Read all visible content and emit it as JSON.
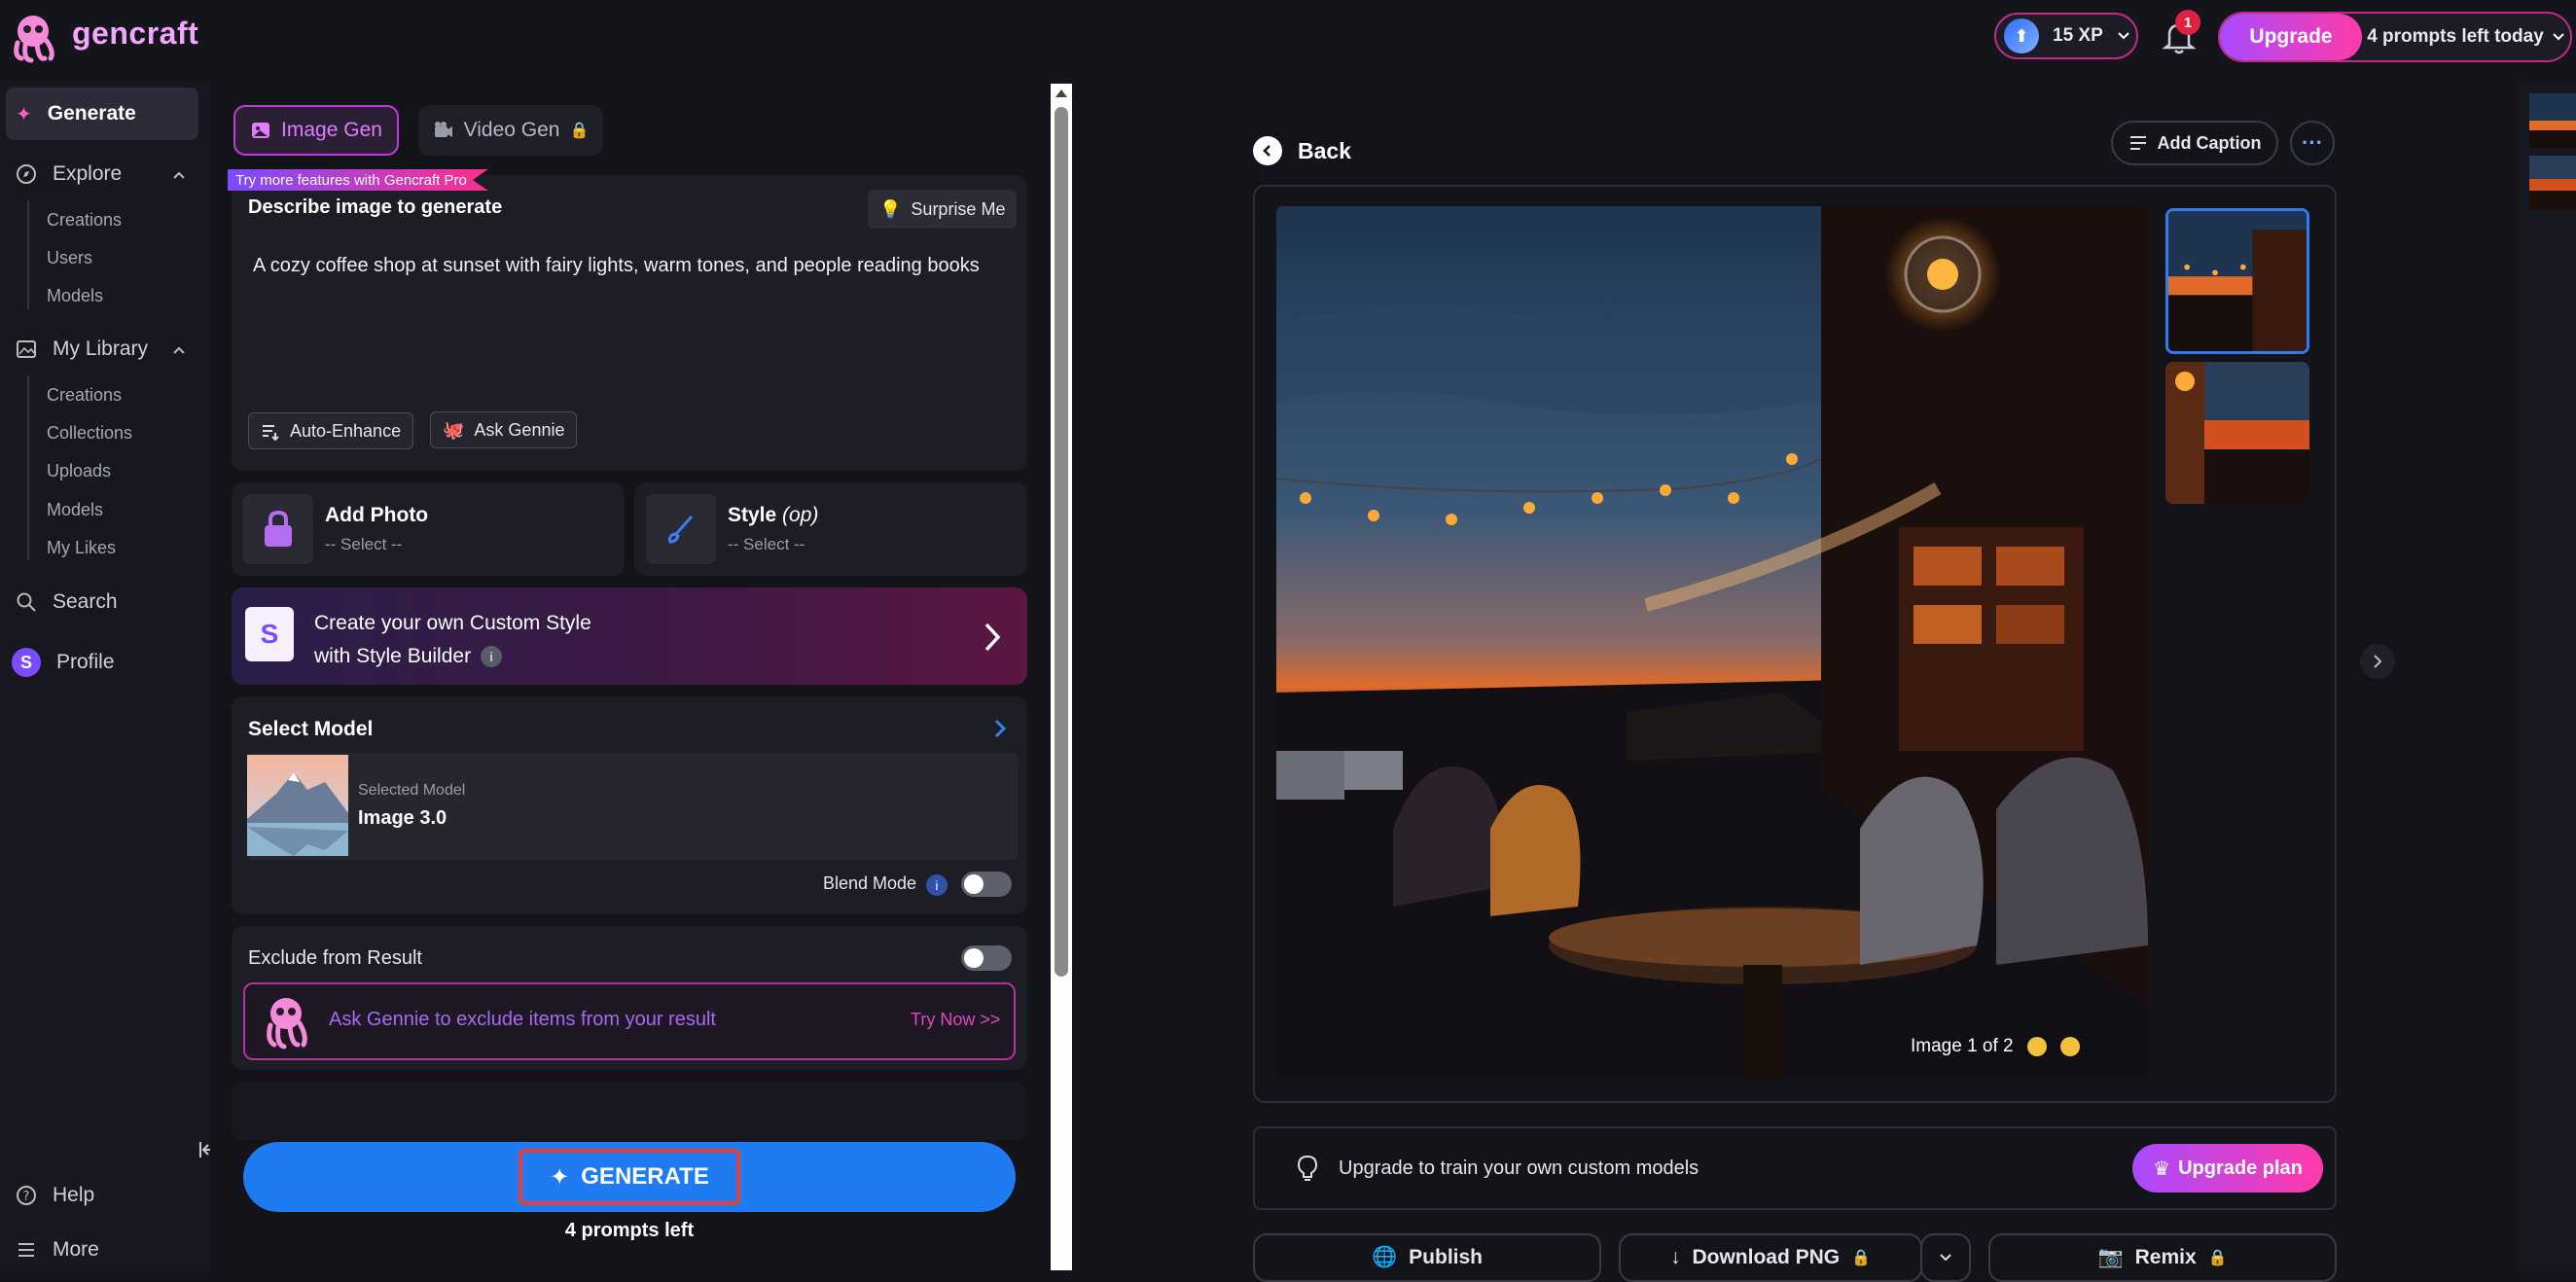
{
  "brand": {
    "name": "gencraft"
  },
  "topbar": {
    "xp": "15 XP",
    "notifications_count": "1",
    "upgrade_label": "Upgrade",
    "prompts_left_today": "4 prompts left today"
  },
  "sidebar": {
    "generate": "Generate",
    "explore": "Explore",
    "explore_items": [
      "Creations",
      "Users",
      "Models"
    ],
    "library": "My Library",
    "library_items": [
      "Creations",
      "Collections",
      "Uploads",
      "Models",
      "My Likes"
    ],
    "search": "Search",
    "profile": "Profile",
    "profile_initial": "S",
    "help": "Help",
    "more": "More"
  },
  "panel": {
    "tab_image": "Image Gen",
    "tab_video": "Video Gen",
    "pro_ribbon": "Try more features with Gencraft Pro",
    "describe_label": "Describe image to generate",
    "surprise_me": "Surprise Me",
    "prompt_text": "A cozy coffee shop at sunset with fairy lights, warm tones, and people reading books",
    "auto_enhance": "Auto-Enhance",
    "ask_gennie": "Ask Gennie",
    "add_photo_title": "Add Photo",
    "add_photo_value": "-- Select --",
    "style_title": "Style",
    "style_optional": "(op)",
    "style_value": "-- Select --",
    "custom_style_line1": "Create your own Custom Style",
    "custom_style_line2": "with Style Builder",
    "select_model_title": "Select Model",
    "selected_model_caption": "Selected Model",
    "selected_model_name": "Image 3.0",
    "blend_mode": "Blend Mode",
    "exclude_title": "Exclude from Result",
    "exclude_gennie_text": "Ask Gennie to exclude items from your result",
    "try_now": "Try Now >>",
    "generate_label": "GENERATE",
    "prompts_left": "4 prompts left"
  },
  "viewer": {
    "back": "Back",
    "add_caption": "Add Caption",
    "image_counter": "Image 1 of 2",
    "upgrade_text": "Upgrade to train your own custom models",
    "upgrade_plan": "Upgrade plan",
    "publish": "Publish",
    "download": "Download PNG",
    "remix": "Remix"
  },
  "colors": {
    "accent_blue": "#1f7bf2",
    "accent_pink": "#ff3aa8",
    "accent_purple": "#a94bff",
    "background": "#13131a"
  }
}
